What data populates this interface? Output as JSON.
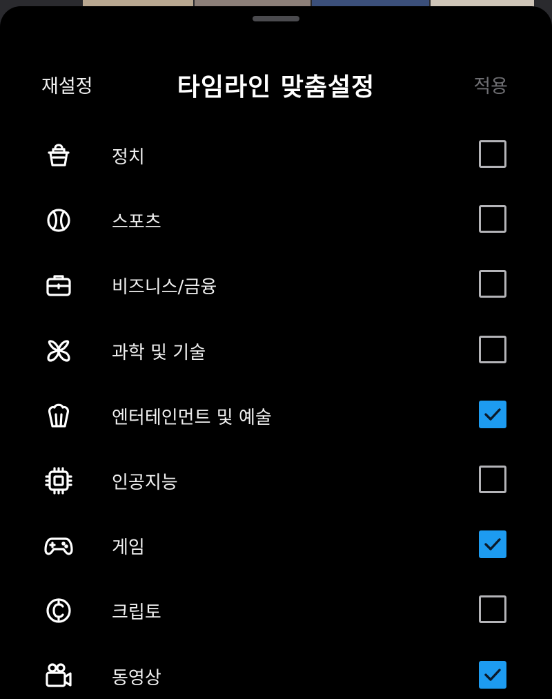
{
  "header": {
    "reset_label": "재설정",
    "title": "타임라인 맞춤설정",
    "apply_label": "적용"
  },
  "colors": {
    "background": "#000000",
    "accent": "#1d9bf0",
    "text": "#ffffff",
    "muted": "#6e6e72"
  },
  "topics": [
    {
      "icon": "ballot-box-icon",
      "label": "정치",
      "checked": false
    },
    {
      "icon": "sports-ball-icon",
      "label": "스포츠",
      "checked": false
    },
    {
      "icon": "briefcase-icon",
      "label": "비즈니스/금융",
      "checked": false
    },
    {
      "icon": "atom-icon",
      "label": "과학 및 기술",
      "checked": false
    },
    {
      "icon": "popcorn-icon",
      "label": "엔터테인먼트 및 예술",
      "checked": true
    },
    {
      "icon": "chip-icon",
      "label": "인공지능",
      "checked": false
    },
    {
      "icon": "gamepad-icon",
      "label": "게임",
      "checked": true
    },
    {
      "icon": "crypto-coin-icon",
      "label": "크립토",
      "checked": false
    },
    {
      "icon": "video-camera-icon",
      "label": "동영상",
      "checked": true
    }
  ]
}
